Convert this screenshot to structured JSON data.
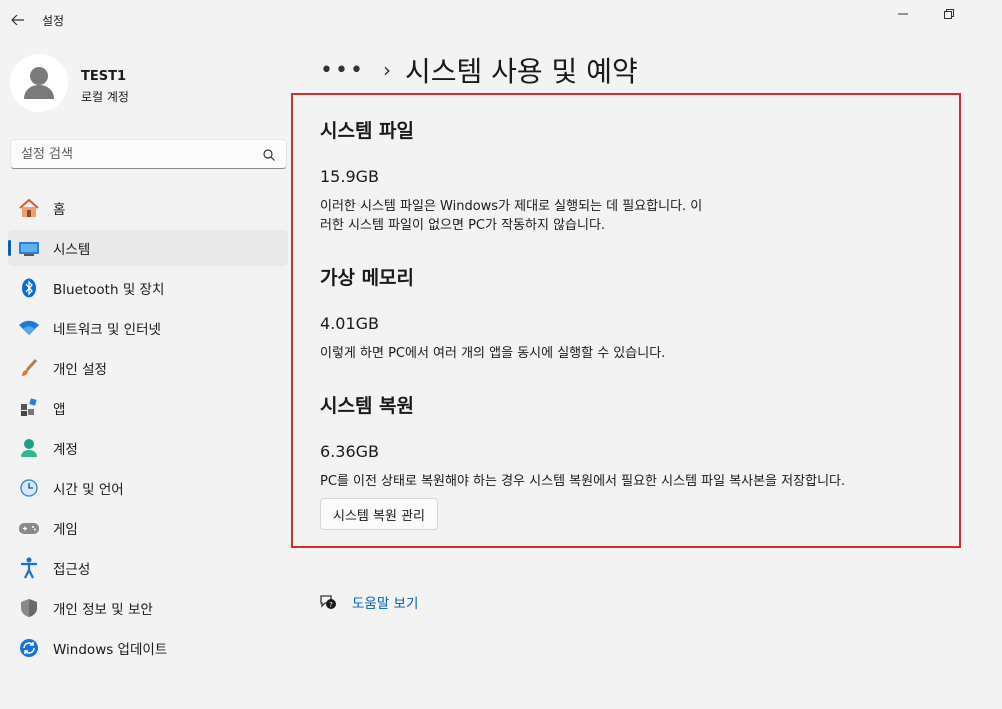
{
  "window": {
    "app_title": "설정"
  },
  "profile": {
    "name": "TEST1",
    "account_type": "로컬 계정"
  },
  "search": {
    "placeholder": "설정 검색"
  },
  "sidebar": {
    "items": [
      {
        "label": "홈",
        "icon": "home-icon",
        "active": false
      },
      {
        "label": "시스템",
        "icon": "system-icon",
        "active": true
      },
      {
        "label": "Bluetooth 및 장치",
        "icon": "bluetooth-icon",
        "active": false
      },
      {
        "label": "네트워크 및 인터넷",
        "icon": "wifi-icon",
        "active": false
      },
      {
        "label": "개인 설정",
        "icon": "brush-icon",
        "active": false
      },
      {
        "label": "앱",
        "icon": "apps-icon",
        "active": false
      },
      {
        "label": "계정",
        "icon": "account-icon",
        "active": false
      },
      {
        "label": "시간 및 언어",
        "icon": "time-language-icon",
        "active": false
      },
      {
        "label": "게임",
        "icon": "gamepad-icon",
        "active": false
      },
      {
        "label": "접근성",
        "icon": "accessibility-icon",
        "active": false
      },
      {
        "label": "개인 정보 및 보안",
        "icon": "shield-icon",
        "active": false
      },
      {
        "label": "Windows 업데이트",
        "icon": "update-icon",
        "active": false
      }
    ]
  },
  "breadcrumb": {
    "more": "•••",
    "separator": "›",
    "title": "시스템 사용 및 예약"
  },
  "sections": [
    {
      "title": "시스템 파일",
      "size": "15.9GB",
      "description_lines": [
        "이러한 시스템 파일은 Windows가 제대로 실행되는 데 필요합니다. 이",
        "러한 시스템 파일이 없으면 PC가 작동하지 않습니다."
      ]
    },
    {
      "title": "가상 메모리",
      "size": "4.01GB",
      "description_lines": [
        "이렇게 하면 PC에서 여러 개의 앱을 동시에 실행할 수 있습니다."
      ]
    },
    {
      "title": "시스템 복원",
      "size": "6.36GB",
      "description_lines": [
        "PC를 이전 상태로 복원해야 하는 경우 시스템 복원에서 필요한 시스템 파일 복사본을 저장합니다."
      ]
    }
  ],
  "restore_button_label": "시스템 복원 관리",
  "help": {
    "link_label": "도움말 보기"
  },
  "colors": {
    "accent": "#005fb8",
    "highlight_border": "#d62c2c",
    "background": "#f3f3f3"
  }
}
